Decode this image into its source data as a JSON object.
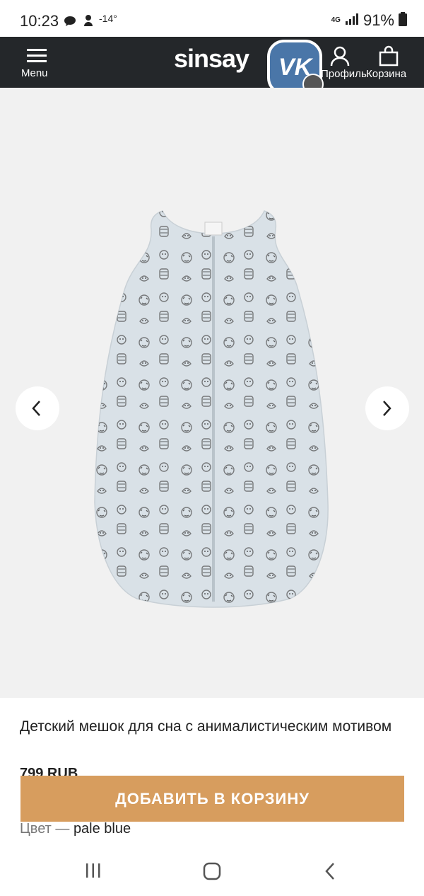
{
  "status_bar": {
    "time": "10:23",
    "temperature": "-14°",
    "network": "4G",
    "battery": "91%",
    "icons": [
      "chat-icon",
      "weather-icon",
      "signal-icon",
      "battery-icon"
    ]
  },
  "header": {
    "menu_label": "Menu",
    "logo": "sinsay",
    "profile_label": "Профиль",
    "cart_label": "Корзина"
  },
  "overlay": {
    "app": "VK",
    "label": "VK"
  },
  "product": {
    "title": "Детский мешок для сна с анималистическим мотивом",
    "price": "799 RUB",
    "add_to_cart_label": "ДОБАВИТЬ В КОРЗИНУ",
    "color_label": "Цвет — ",
    "color_value": "pale blue"
  },
  "colors": {
    "header_bg": "#24272a",
    "gallery_bg": "#f1f1f1",
    "add_button": "#d79d5e",
    "product_fabric": "#d9e1e7",
    "vk_brand": "#4a76a8"
  }
}
